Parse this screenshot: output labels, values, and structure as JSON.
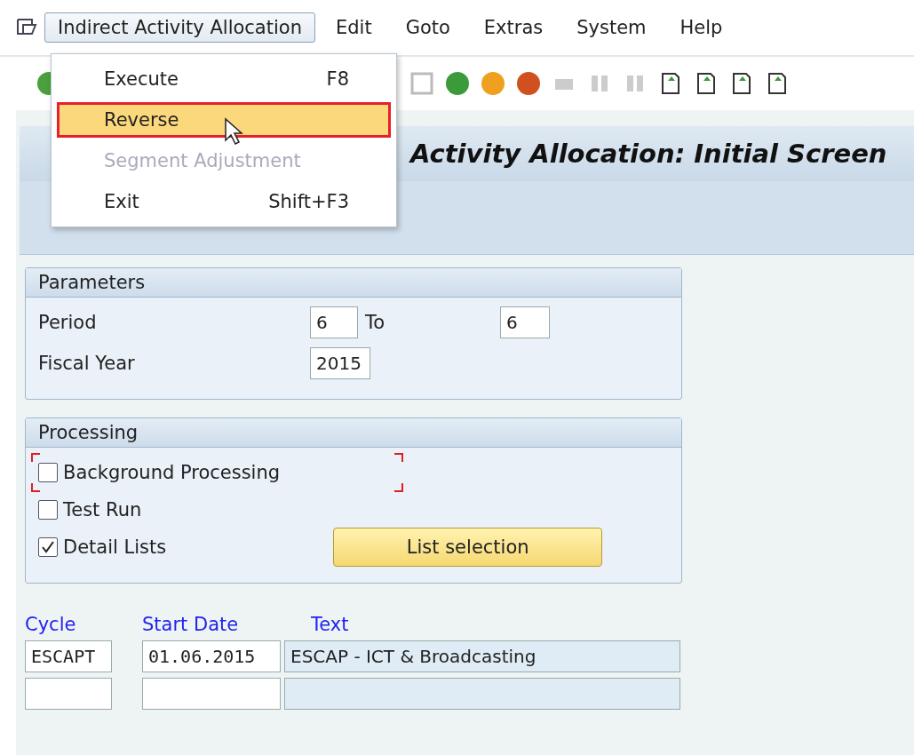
{
  "menu_bar": {
    "items": [
      {
        "label": "Indirect Activity Allocation",
        "selected": true
      },
      {
        "label": "Edit",
        "selected": false
      },
      {
        "label": "Goto",
        "selected": false
      },
      {
        "label": "Extras",
        "selected": false
      },
      {
        "label": "System",
        "selected": false
      },
      {
        "label": "Help",
        "selected": false
      }
    ]
  },
  "menu": {
    "items": [
      {
        "label": "Execute",
        "shortcut": "F8",
        "disabled": false,
        "selected": false
      },
      {
        "label": "Reverse",
        "disabled": false,
        "selected": true
      },
      {
        "label": "Segment Adjustment",
        "disabled": true,
        "selected": false
      },
      {
        "label": "Exit",
        "shortcut": "Shift+F3",
        "disabled": false,
        "selected": false
      }
    ]
  },
  "title": "Activity Allocation: Initial Screen",
  "parameters": {
    "title": "Parameters",
    "period_label": "Period",
    "period_from": "6",
    "to_label": "To",
    "period_to": "6",
    "year_label": "Fiscal Year",
    "year": "2015"
  },
  "processing": {
    "title": "Processing",
    "options": [
      {
        "label": "Background Processing",
        "checked": false,
        "focused": true
      },
      {
        "label": "Test Run",
        "checked": false,
        "focused": false
      },
      {
        "label": "Detail Lists",
        "checked": true,
        "focused": false
      }
    ],
    "button": "List selection"
  },
  "table": {
    "columns": [
      "Cycle",
      "Start Date",
      "Text"
    ],
    "rows": [
      [
        "ESCAPT",
        "01.06.2015",
        "ESCAP - ICT & Broadcasting"
      ],
      [
        "",
        "",
        ""
      ]
    ]
  }
}
